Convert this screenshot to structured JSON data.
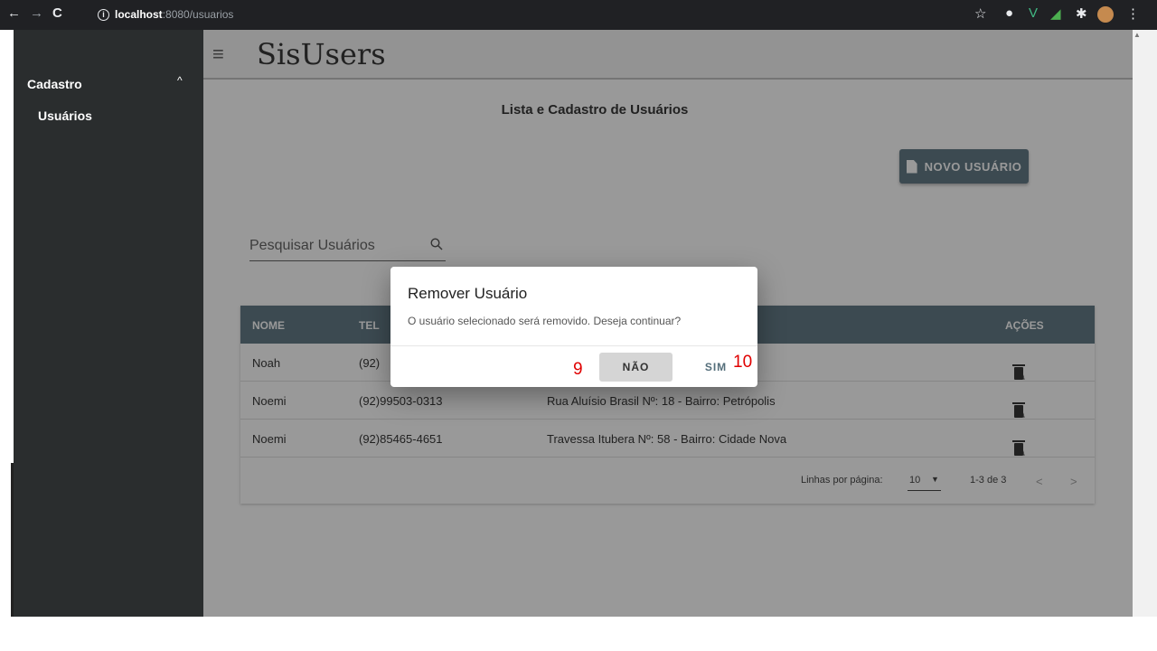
{
  "browser": {
    "url_host": "localhost",
    "url_path": ":8080/usuarios",
    "back": "←",
    "forward": "→",
    "reload": "C",
    "info": "i"
  },
  "sidebar": {
    "group_label": "Cadastro",
    "group_chevron": "^",
    "items": [
      {
        "label": "Usuários"
      }
    ]
  },
  "appbar": {
    "menu_glyph": "≡",
    "title": "SisUsers"
  },
  "page": {
    "heading": "Lista e Cadastro de Usuários",
    "new_button_label": "NOVO USUÁRIO",
    "search_placeholder": "Pesquisar Usuários"
  },
  "table": {
    "headers": {
      "name": "NOME",
      "phone": "TEL",
      "actions": "AÇÕES"
    },
    "rows": [
      {
        "name": "Noah",
        "phone": "(92)",
        "address": ""
      },
      {
        "name": "Noemi",
        "phone": "(92)99503-0313",
        "address": "Rua Aluísio Brasil Nº: 18 - Bairro: Petrópolis"
      },
      {
        "name": "Noemi",
        "phone": "(92)85465-4651",
        "address": "Travessa Itubera Nº: 58 - Bairro: Cidade Nova"
      }
    ],
    "footer": {
      "rows_per_page_label": "Linhas por página:",
      "rows_per_page_value": "10",
      "range": "1-3 de 3"
    }
  },
  "dialog": {
    "title": "Remover Usuário",
    "message": "O usuário selecionado será removido. Deseja continuar?",
    "cancel_label": "NÃO",
    "confirm_label": "SIM"
  },
  "annotations": {
    "marker_a": "9",
    "marker_b": "10"
  },
  "colors": {
    "accent": "#546e7a",
    "sidebar": "#2a2d2e",
    "marker": "#e00000"
  }
}
